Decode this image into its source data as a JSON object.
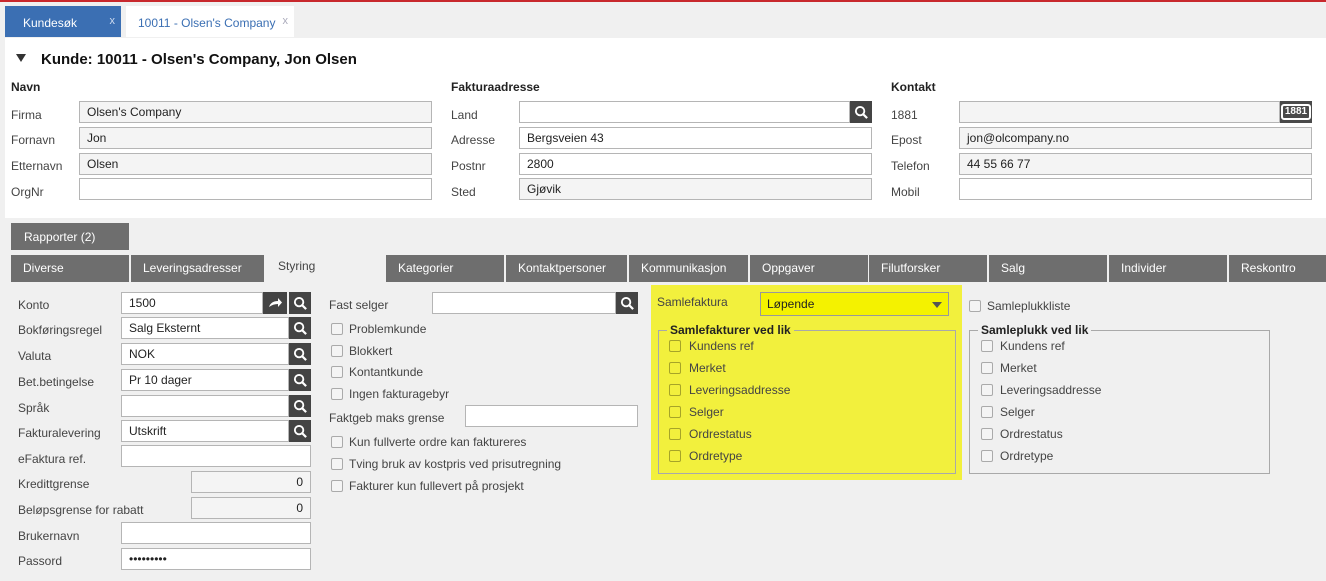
{
  "window_tabs": [
    {
      "label": "Kundesøk",
      "close": "x"
    },
    {
      "label": "10011 - Olsen's Company",
      "close": "x"
    }
  ],
  "page_title": "Kunde: 10011 - Olsen's Company, Jon Olsen",
  "navn": {
    "header": "Navn",
    "firma_label": "Firma",
    "firma_value": "Olsen's Company",
    "fornavn_label": "Fornavn",
    "fornavn_value": "Jon",
    "etternavn_label": "Etternavn",
    "etternavn_value": "Olsen",
    "orgnr_label": "OrgNr",
    "orgnr_value": ""
  },
  "faktura": {
    "header": "Fakturaadresse",
    "land_label": "Land",
    "land_value": "",
    "adresse_label": "Adresse",
    "adresse_value": "Bergsveien 43",
    "postnr_label": "Postnr",
    "postnr_value": "2800",
    "sted_label": "Sted",
    "sted_value": "Gjøvik"
  },
  "kontakt": {
    "header": "Kontakt",
    "k1881_label": "1881",
    "k1881_value": "",
    "k1881_btn": "1881",
    "epost_label": "Epost",
    "epost_value": "jon@olcompany.no",
    "telefon_label": "Telefon",
    "telefon_value": "44 55 66 77",
    "mobil_label": "Mobil",
    "mobil_value": ""
  },
  "rapporter_tab": "Rapporter (2)",
  "content_tabs": [
    "Diverse",
    "Leveringsadresser",
    "Styring",
    "Kategorier",
    "Kontaktpersoner",
    "Kommunikasjon",
    "Oppgaver",
    "Filutforsker",
    "Salg",
    "Individer",
    "Reskontro"
  ],
  "styring": {
    "konto_label": "Konto",
    "konto_value": "1500",
    "bokf_label": "Bokføringsregel",
    "bokf_value": "Salg Eksternt",
    "valuta_label": "Valuta",
    "valuta_value": "NOK",
    "betb_label": "Bet.betingelse",
    "betb_value": "Pr 10 dager",
    "sprak_label": "Språk",
    "sprak_value": "",
    "faktlev_label": "Fakturalevering",
    "faktlev_value": "Utskrift",
    "efakt_label": "eFaktura ref.",
    "efakt_value": "",
    "kreditt_label": "Kredittgrense",
    "kreditt_value": "0",
    "belop_label": "Beløpsgrense for rabatt",
    "belop_value": "0",
    "bruker_label": "Brukernavn",
    "bruker_value": "",
    "passord_label": "Passord",
    "passord_value": "•••••••••"
  },
  "mid": {
    "fastselger_label": "Fast selger",
    "fastselger_value": "",
    "checks1": [
      "Problemkunde",
      "Blokkert",
      "Kontantkunde",
      "Ingen fakturagebyr"
    ],
    "faktgeb_label": "Faktgeb maks grense",
    "faktgeb_value": "",
    "checks2": [
      "Kun fullverte ordre kan faktureres",
      "Tving bruk av kostpris ved prisutregning",
      "Fakturer kun fullevert på prosjekt"
    ]
  },
  "samlefaktura": {
    "label": "Samlefaktura",
    "value": "Løpende",
    "group_title": "Samlefakturer ved lik",
    "items": [
      "Kundens ref",
      "Merket",
      "Leveringsaddresse",
      "Selger",
      "Ordrestatus",
      "Ordretype"
    ],
    "highlight_color": "#f2f03d"
  },
  "samleplukk": {
    "checkbox_label": "Samleplukkliste",
    "group_title": "Samleplukk ved lik",
    "items": [
      "Kundens ref",
      "Merket",
      "Leveringsaddresse",
      "Selger",
      "Ordrestatus",
      "Ordretype"
    ]
  }
}
